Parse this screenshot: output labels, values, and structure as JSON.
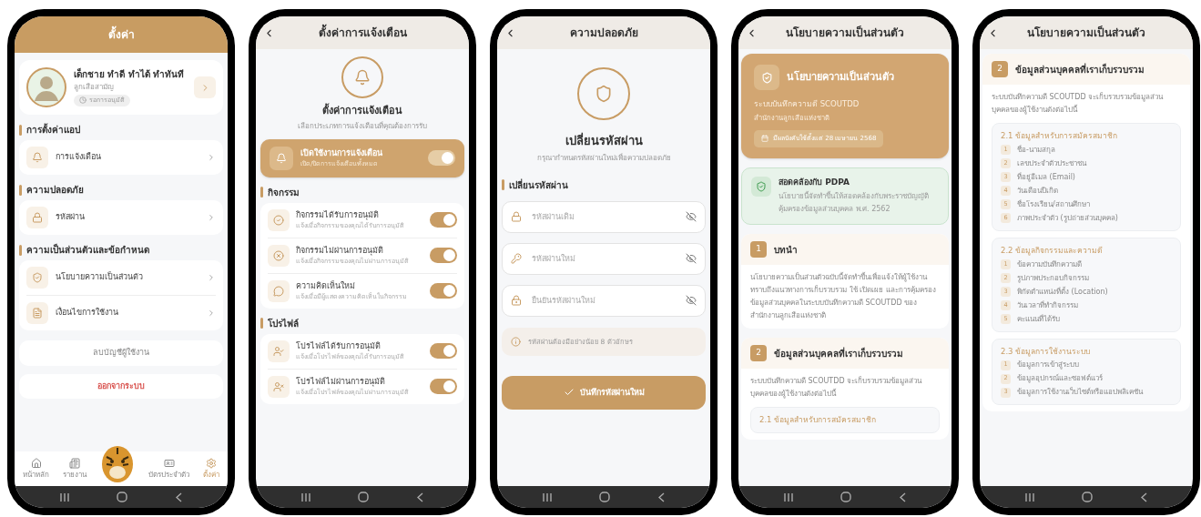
{
  "screens": [
    {
      "kind": "settings",
      "title": "ตั้งค่า",
      "profile": {
        "name": "เด็กชาย ทำดี ทำได้ ทำทันที",
        "role": "ลูกเสือสามัญ",
        "status": "รอการอนุมัติ"
      },
      "sections": [
        {
          "title": "การตั้งค่าแอป",
          "items": [
            "การแจ้งเตือน"
          ]
        },
        {
          "title": "ความปลอดภัย",
          "items": [
            "รหัสผ่าน"
          ]
        },
        {
          "title": "ความเป็นส่วนตัวและข้อกำหนด",
          "items": [
            "นโยบายความเป็นส่วนตัว",
            "เงื่อนไขการใช้งาน"
          ]
        }
      ],
      "delete_account": "ลบบัญชีผู้ใช้งาน",
      "logout": "ออกจากระบบ",
      "nav": [
        {
          "label": "หน้าหลัก",
          "selected": false
        },
        {
          "label": "รายงาน",
          "selected": false
        },
        {
          "label": "บัตรประจำตัว",
          "selected": false
        },
        {
          "label": "ตั้งค่า",
          "selected": true
        }
      ]
    },
    {
      "kind": "notifications",
      "title": "ตั้งค่าการแจ้งเตือน",
      "heading": "ตั้งค่าการแจ้งเตือน",
      "subtitle": "เลือกประเภทการแจ้งเตือนที่คุณต้องการรับ",
      "master": {
        "title": "เปิดใช้งานการแจ้งเตือน",
        "description": "เปิด/ปิดการแจ้งเตือนทั้งหมด",
        "on": true
      },
      "groups": [
        {
          "title": "กิจกรรม",
          "items": [
            {
              "title": "กิจกรรมได้รับการอนุมัติ",
              "description": "แจ้งเมื่อกิจกรรมของคุณได้รับการอนุมัติ",
              "on": true
            },
            {
              "title": "กิจกรรมไม่ผ่านการอนุมัติ",
              "description": "แจ้งเมื่อกิจกรรมของคุณไม่ผ่านการอนุมัติ",
              "on": true
            },
            {
              "title": "ความคิดเห็นใหม่",
              "description": "แจ้งเมื่อมีผู้แสดงความคิดเห็นในกิจกรรม",
              "on": true
            }
          ]
        },
        {
          "title": "โปรไฟล์",
          "items": [
            {
              "title": "โปรไฟล์ได้รับการอนุมัติ",
              "description": "แจ้งเมื่อโปรไฟล์ของคุณได้รับการอนุมัติ",
              "on": true
            },
            {
              "title": "โปรไฟล์ไม่ผ่านการอนุมัติ",
              "description": "แจ้งเมื่อโปรไฟล์ของคุณไม่ผ่านการอนุมัติ",
              "on": true
            }
          ]
        }
      ]
    },
    {
      "kind": "password",
      "title": "ความปลอดภัย",
      "heading": "เปลี่ยนรหัสผ่าน",
      "subtitle": "กรุณากำหนดรหัสผ่านใหม่เพื่อความปลอดภัย",
      "section": "เปลี่ยนรหัสผ่าน",
      "fields": [
        {
          "placeholder": "รหัสผ่านเดิม"
        },
        {
          "placeholder": "รหัสผ่านใหม่"
        },
        {
          "placeholder": "ยืนยันรหัสผ่านใหม่"
        }
      ],
      "hint": "รหัสผ่านต้องมีอย่างน้อย 8 ตัวอักษร",
      "button": "บันทึกรหัสผ่านใหม่"
    },
    {
      "kind": "policy",
      "title": "นโยบายความเป็นส่วนตัว",
      "hero": {
        "title": "นโยบายความเป็นส่วนตัว",
        "system": "ระบบบันทึกความดี SCOUTDD",
        "office": "สำนักงานลูกเสือแห่งชาติ",
        "effective": "มีผลบังคับใช้ตั้งแต่ 28 เมษายน 2568"
      },
      "pdpa": {
        "title": "สอดคล้องกับ PDPA",
        "text": "นโยบายนี้จัดทำขึ้นให้สอดคล้องกับพระราชบัญญัติคุ้มครองข้อมูลส่วนบุคคล พ.ศ. 2562"
      },
      "sections": [
        {
          "number": "1",
          "title": "บทนำ",
          "text": "นโยบายความเป็นส่วนตัวฉบับนี้จัดทำขึ้นเพื่อแจ้งให้ผู้ใช้งานทราบถึงแนวทางการเก็บรวบรวม ใช้ เปิดเผย และการคุ้มครองข้อมูลส่วนบุคคลในระบบบันทึกความดี SCOUTDD ของสำนักงานลูกเสือแห่งชาติ"
        },
        {
          "number": "2",
          "title": "ข้อมูลส่วนบุคคลที่เราเก็บรวบรวม",
          "text": "ระบบบันทึกความดี SCOUTDD จะเก็บรวบรวมข้อมูลส่วนบุคคลของผู้ใช้งานดังต่อไปนี้",
          "subsections": [
            {
              "title": "2.1 ข้อมูลสำหรับการสมัครสมาชิก"
            }
          ]
        }
      ]
    },
    {
      "kind": "policy",
      "title": "นโยบายความเป็นส่วนตัว",
      "sections": [
        {
          "number": "2",
          "title": "ข้อมูลส่วนบุคคลที่เราเก็บรวบรวม",
          "text": "ระบบบันทึกความดี SCOUTDD จะเก็บรวบรวมข้อมูลส่วนบุคคลของผู้ใช้งานดังต่อไปนี้",
          "subsections": [
            {
              "title": "2.1 ข้อมูลสำหรับการสมัครสมาชิก",
              "items": [
                {
                  "number": "1",
                  "text": "ชื่อ-นามสกุล"
                },
                {
                  "number": "2",
                  "text": "เลขประจำตัวประชาชน"
                },
                {
                  "number": "3",
                  "text": "ที่อยู่อีเมล (Email)"
                },
                {
                  "number": "4",
                  "text": "วันเดือนปีเกิด"
                },
                {
                  "number": "5",
                  "text": "ชื่อโรงเรียน/สถานศึกษา"
                },
                {
                  "number": "6",
                  "text": "ภาพประจำตัว (รูปถ่ายส่วนบุคคล)"
                }
              ]
            },
            {
              "title": "2.2 ข้อมูลกิจกรรมและความดี",
              "items": [
                {
                  "number": "1",
                  "text": "ข้อความบันทึกความดี"
                },
                {
                  "number": "2",
                  "text": "รูปภาพประกอบกิจกรรม"
                },
                {
                  "number": "3",
                  "text": "พิกัดตำแหน่งที่ตั้ง (Location)"
                },
                {
                  "number": "4",
                  "text": "วันเวลาที่ทำกิจกรรม"
                },
                {
                  "number": "5",
                  "text": "คะแนนที่ได้รับ"
                }
              ]
            },
            {
              "title": "2.3 ข้อมูลการใช้งานระบบ",
              "items": [
                {
                  "number": "1",
                  "text": "ข้อมูลการเข้าสู่ระบบ"
                },
                {
                  "number": "2",
                  "text": "ข้อมูลอุปกรณ์และซอฟต์แวร์"
                },
                {
                  "number": "3",
                  "text": "ข้อมูลการใช้งานเว็บไซต์หรือแอปพลิเคชัน"
                }
              ]
            }
          ]
        }
      ]
    }
  ]
}
